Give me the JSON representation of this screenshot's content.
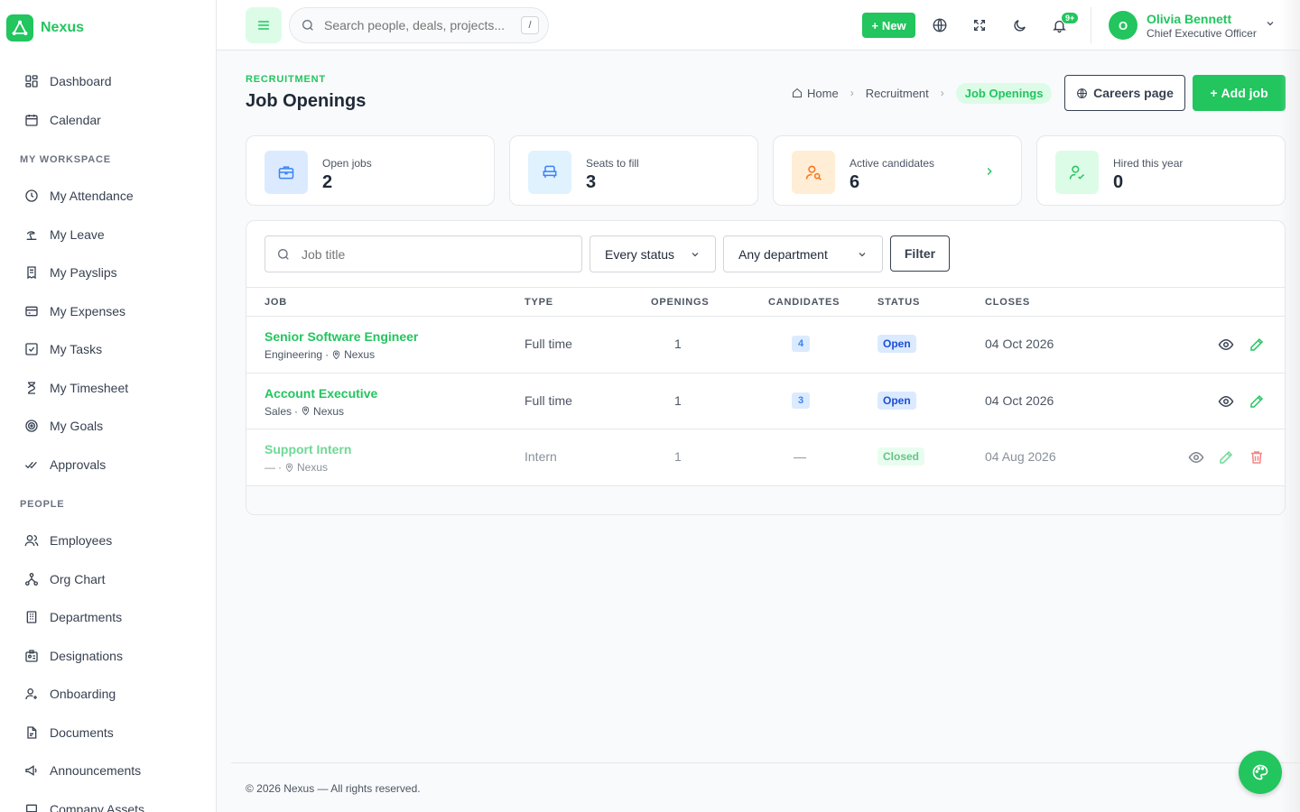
{
  "brand": {
    "name": "Nexus",
    "accent": "#22c55e"
  },
  "sidebar": {
    "top_items": [
      {
        "label": "Dashboard",
        "icon": "dashboard-icon"
      },
      {
        "label": "Calendar",
        "icon": "calendar-icon"
      }
    ],
    "workspace_title": "MY WORKSPACE",
    "workspace_items": [
      {
        "label": "My Attendance",
        "icon": "clock-icon"
      },
      {
        "label": "My Leave",
        "icon": "beach-icon"
      },
      {
        "label": "My Payslips",
        "icon": "receipt-icon"
      },
      {
        "label": "My Expenses",
        "icon": "card-icon"
      },
      {
        "label": "My Tasks",
        "icon": "checkbox-icon"
      },
      {
        "label": "My Timesheet",
        "icon": "hourglass-icon"
      },
      {
        "label": "My Goals",
        "icon": "target-icon"
      },
      {
        "label": "Approvals",
        "icon": "double-check-icon"
      }
    ],
    "people_title": "PEOPLE",
    "people_items": [
      {
        "label": "Employees",
        "icon": "users-icon"
      },
      {
        "label": "Org Chart",
        "icon": "hierarchy-icon"
      },
      {
        "label": "Departments",
        "icon": "building-icon"
      },
      {
        "label": "Designations",
        "icon": "id-badge-icon"
      },
      {
        "label": "Onboarding",
        "icon": "user-plus-icon"
      },
      {
        "label": "Documents",
        "icon": "document-icon"
      },
      {
        "label": "Announcements",
        "icon": "megaphone-icon"
      },
      {
        "label": "Company Assets",
        "icon": "laptop-icon"
      }
    ]
  },
  "topbar": {
    "search_placeholder": "Search people, deals, projects...",
    "search_shortcut": "/",
    "new_label": "New",
    "notification_badge": "9+",
    "user": {
      "initial": "O",
      "name": "Olivia Bennett",
      "role": "Chief Executive Officer"
    }
  },
  "page": {
    "eyebrow": "RECRUITMENT",
    "title": "Job Openings",
    "breadcrumb": {
      "home": "Home",
      "section": "Recruitment",
      "current": "Job Openings"
    },
    "careers_label": "Careers page",
    "add_label": "Add job"
  },
  "stats": [
    {
      "label": "Open jobs",
      "value": "2",
      "icon": "briefcase-icon",
      "bg": "#dbeafe",
      "fg": "#3b82f6"
    },
    {
      "label": "Seats to fill",
      "value": "3",
      "icon": "chair-icon",
      "bg": "#e0f2fe",
      "fg": "#3b82f6"
    },
    {
      "label": "Active candidates",
      "value": "6",
      "icon": "user-search-icon",
      "bg": "#ffedd5",
      "fg": "#f97316"
    },
    {
      "label": "Hired this year",
      "value": "0",
      "icon": "user-check-icon",
      "bg": "#dcfce7",
      "fg": "#22c55e"
    }
  ],
  "filters": {
    "search_placeholder": "Job title",
    "status_value": "Every status",
    "department_value": "Any department",
    "filter_label": "Filter"
  },
  "table": {
    "columns": [
      "JOB",
      "TYPE",
      "OPENINGS",
      "CANDIDATES",
      "STATUS",
      "CLOSES"
    ],
    "rows": [
      {
        "title": "Senior Software Engineer",
        "department": "Engineering",
        "location": "Nexus",
        "type": "Full time",
        "openings": "1",
        "candidates": "4",
        "status": "Open",
        "closes": "04 Oct 2026"
      },
      {
        "title": "Account Executive",
        "department": "Sales",
        "location": "Nexus",
        "type": "Full time",
        "openings": "1",
        "candidates": "3",
        "status": "Open",
        "closes": "04 Oct 2026"
      },
      {
        "title": "Support Intern",
        "department": "—",
        "location": "Nexus",
        "type": "Intern",
        "openings": "1",
        "candidates": "—",
        "status": "Closed",
        "closes": "04 Aug 2026"
      }
    ]
  },
  "footer": {
    "text": "© 2026 Nexus — All rights reserved."
  },
  "colors": {
    "open_bg": "#dbeafe",
    "open_fg": "#1d4ed8",
    "closed_bg": "#dcfce7",
    "closed_fg": "#16a34a",
    "danger": "#ef4444"
  }
}
